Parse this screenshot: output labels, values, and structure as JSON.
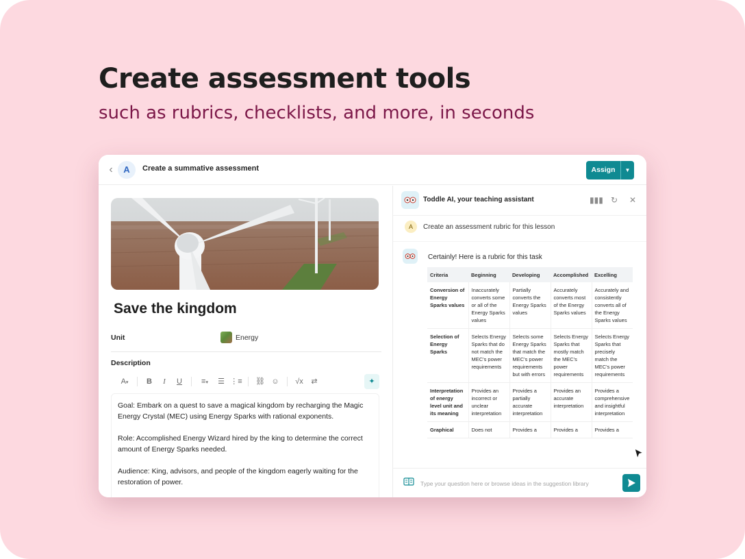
{
  "promo": {
    "headline": "Create assessment tools",
    "subheadline": "such as rubrics, checklists, and more, in seconds"
  },
  "colors": {
    "background": "#fdd9e0",
    "accent": "#0f8a92",
    "subheadline": "#7b1748"
  },
  "topbar": {
    "avatar_letter": "A",
    "title": "Create a summative assessment",
    "assign_label": "Assign"
  },
  "document": {
    "title": "Save the kingdom",
    "unit_label": "Unit",
    "unit_value": "Energy",
    "description_label": "Description",
    "toolbar": [
      "font-color-icon",
      "bold-icon",
      "italic-icon",
      "underline-icon",
      "align-icon",
      "bullet-list-icon",
      "numbered-list-icon",
      "link-icon",
      "emoji-icon",
      "formula-icon",
      "swap-icon",
      "ai-sparkle-icon"
    ],
    "paragraphs": [
      "Goal: Embark on a quest to save a magical kingdom by recharging the Magic Energy Crystal (MEC) using Energy Sparks with rational exponents.",
      "Role: Accomplished Energy Wizard hired by the king to determine the correct amount of Energy Sparks needed.",
      "Audience: King, advisors, and people of the kingdom eagerly waiting for the restoration of power."
    ]
  },
  "assistant": {
    "title": "Toddle AI, your teaching assistant",
    "user_avatar": "A",
    "user_message": "Create an assessment rubric for this lesson",
    "reply": "Certainly! Here is a rubric for this task",
    "input_placeholder": "Type your question here or browse ideas in the suggestion library",
    "rubric": {
      "headers": [
        "Criteria",
        "Beginning",
        "Developing",
        "Accomplished",
        "Excelling"
      ],
      "rows": [
        [
          "Conversion of Energy Sparks values",
          "Inaccurately converts some or all of the Energy Sparks values",
          "Partially converts the Energy Sparks values",
          "Accurately converts most of the Energy Sparks values",
          "Accurately and consistently converts all of the Energy Sparks values"
        ],
        [
          "Selection of Energy Sparks",
          "Selects Energy Sparks that do not match the MEC's power requirements",
          "Selects some Energy Sparks that match the MEC's power requirements but with errors",
          "Selects Energy Sparks that mostly match the MEC's power requirements",
          "Selects Energy Sparks that precisely match the MEC's power requirements"
        ],
        [
          "Interpretation of energy level unit and its meaning",
          "Provides an incorrect or unclear interpretation",
          "Provides a partially accurate interpretation",
          "Provides an accurate interpretation",
          "Provides a comprehensive and insightful interpretation"
        ],
        [
          "Graphical",
          "Does not",
          "Provides a",
          "Provides a",
          "Provides a"
        ]
      ]
    }
  }
}
